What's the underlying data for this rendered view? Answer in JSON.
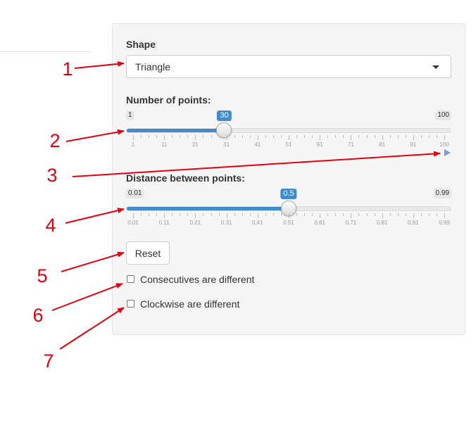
{
  "shape": {
    "label": "Shape",
    "selected": "Triangle"
  },
  "points": {
    "label": "Number of points:",
    "min_label": "1",
    "max_label": "100",
    "value_label": "30",
    "value": 30,
    "min": 1,
    "max": 100,
    "ticks": [
      "1",
      "11",
      "21",
      "31",
      "41",
      "51",
      "61",
      "71",
      "81",
      "91",
      "100"
    ]
  },
  "distance": {
    "label": "Distance between points:",
    "min_label": "0.01",
    "max_label": "0.99",
    "value_label": "0.5",
    "value": 0.5,
    "min": 0.01,
    "max": 0.99,
    "ticks": [
      "0.01",
      "0.11",
      "0.21",
      "0.31",
      "0.41",
      "0.51",
      "0.61",
      "0.71",
      "0.81",
      "0.91",
      "0.99"
    ]
  },
  "reset_label": "Reset",
  "checkboxes": [
    {
      "label": "Consecutives are different",
      "checked": false
    },
    {
      "label": "Clockwise are different",
      "checked": false
    }
  ],
  "annotations": [
    "1",
    "2",
    "3",
    "4",
    "5",
    "6",
    "7"
  ],
  "colors": {
    "accent": "#428bca",
    "annotation": "#e3000f",
    "play": "#6c9fd8"
  },
  "icons": {
    "play": "play-icon",
    "dropdown": "caret-down-icon"
  }
}
